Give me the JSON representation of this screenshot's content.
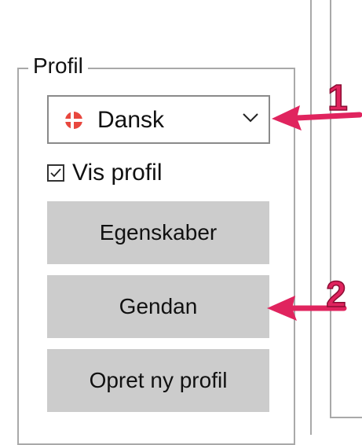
{
  "group": {
    "title": "Profil"
  },
  "language_select": {
    "selected": "Dansk",
    "flag_icon": "denmark-flag-icon",
    "chevron_icon": "chevron-down-icon"
  },
  "show_profile": {
    "label": "Vis profil",
    "checked": true
  },
  "buttons": {
    "properties": "Egenskaber",
    "restore": "Gendan",
    "new_profile": "Opret ny profil"
  },
  "annotations": [
    {
      "label": "1",
      "target": "language_select"
    },
    {
      "label": "2",
      "target": "restore"
    }
  ],
  "colors": {
    "annotation": "#e0245e",
    "button_bg": "#cccccc",
    "flag_red": "#e8473e"
  }
}
